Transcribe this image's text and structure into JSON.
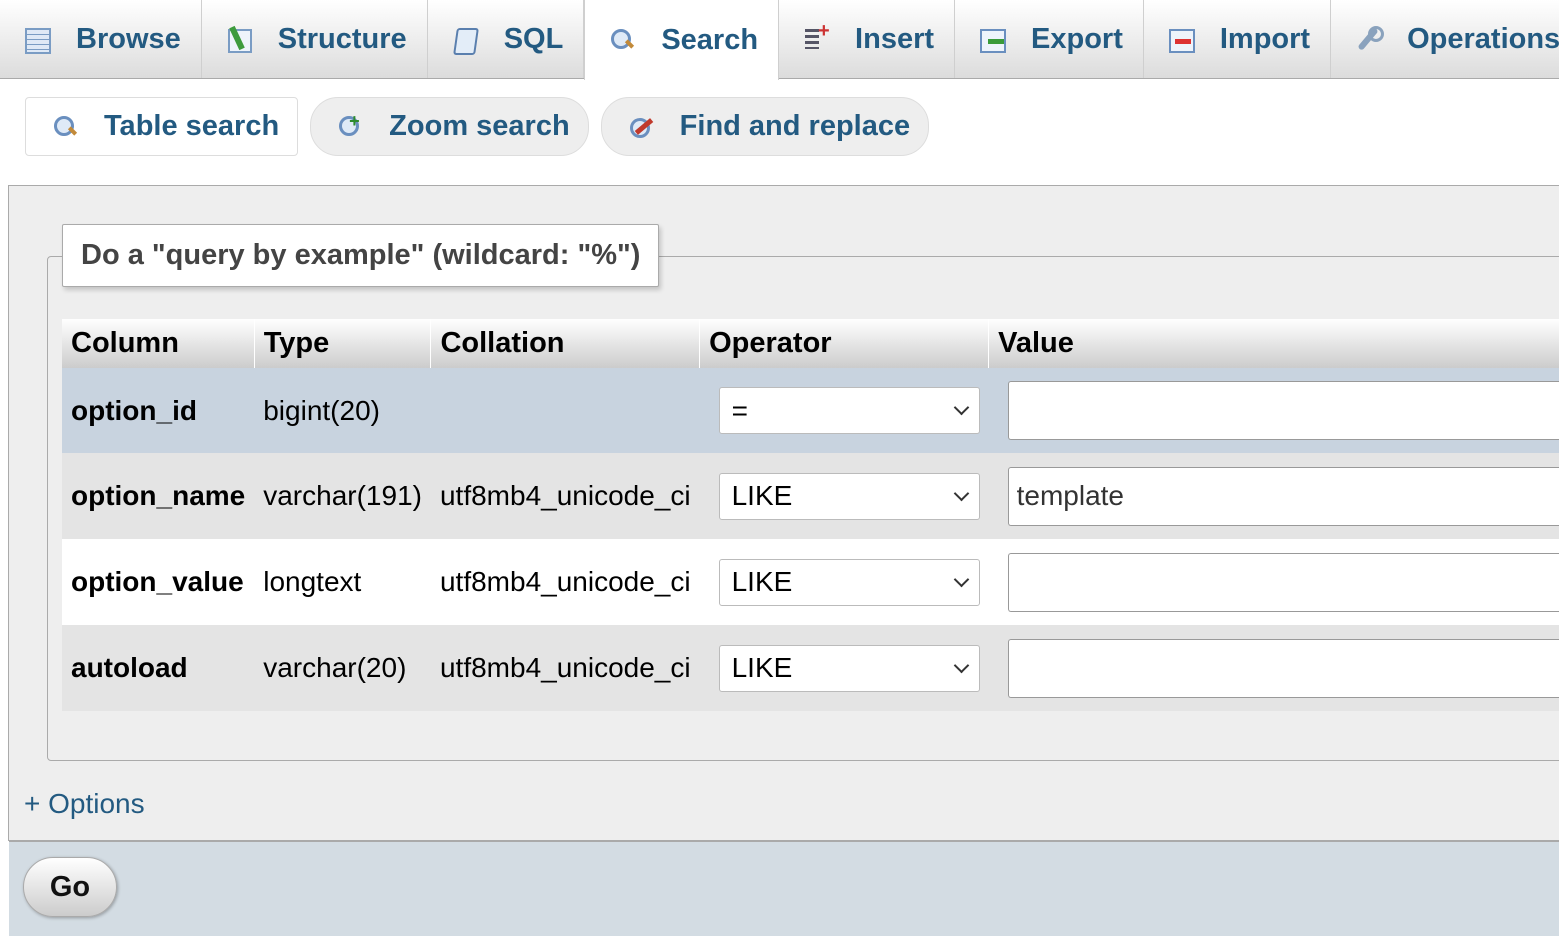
{
  "tabs": [
    {
      "label": "Browse",
      "icon": "table-icon"
    },
    {
      "label": "Structure",
      "icon": "structure-icon"
    },
    {
      "label": "SQL",
      "icon": "sql-icon"
    },
    {
      "label": "Search",
      "icon": "search-icon",
      "active": true
    },
    {
      "label": "Insert",
      "icon": "insert-icon"
    },
    {
      "label": "Export",
      "icon": "export-icon"
    },
    {
      "label": "Import",
      "icon": "import-icon"
    },
    {
      "label": "Operations",
      "icon": "wrench-icon"
    }
  ],
  "subtabs": [
    {
      "label": "Table search",
      "icon": "search-icon",
      "active": true
    },
    {
      "label": "Zoom search",
      "icon": "zoom-icon"
    },
    {
      "label": "Find and replace",
      "icon": "find-replace-icon"
    }
  ],
  "form": {
    "legend": "Do a \"query by example\" (wildcard: \"%\")",
    "headers": {
      "column": "Column",
      "type": "Type",
      "collation": "Collation",
      "operator": "Operator",
      "value": "Value"
    },
    "rows": [
      {
        "column": "option_id",
        "type": "bigint(20)",
        "collation": "",
        "operator": "=",
        "value": ""
      },
      {
        "column": "option_name",
        "type": "varchar(191)",
        "collation": "utf8mb4_unicode_ci",
        "operator": "LIKE",
        "value": "template"
      },
      {
        "column": "option_value",
        "type": "longtext",
        "collation": "utf8mb4_unicode_ci",
        "operator": "LIKE",
        "value": ""
      },
      {
        "column": "autoload",
        "type": "varchar(20)",
        "collation": "utf8mb4_unicode_ci",
        "operator": "LIKE",
        "value": ""
      }
    ],
    "options_link": "+ Options",
    "go_label": "Go"
  },
  "colors": {
    "link": "#235a81",
    "highlight_row": "#c8d3df",
    "footer": "#d3dce3"
  }
}
